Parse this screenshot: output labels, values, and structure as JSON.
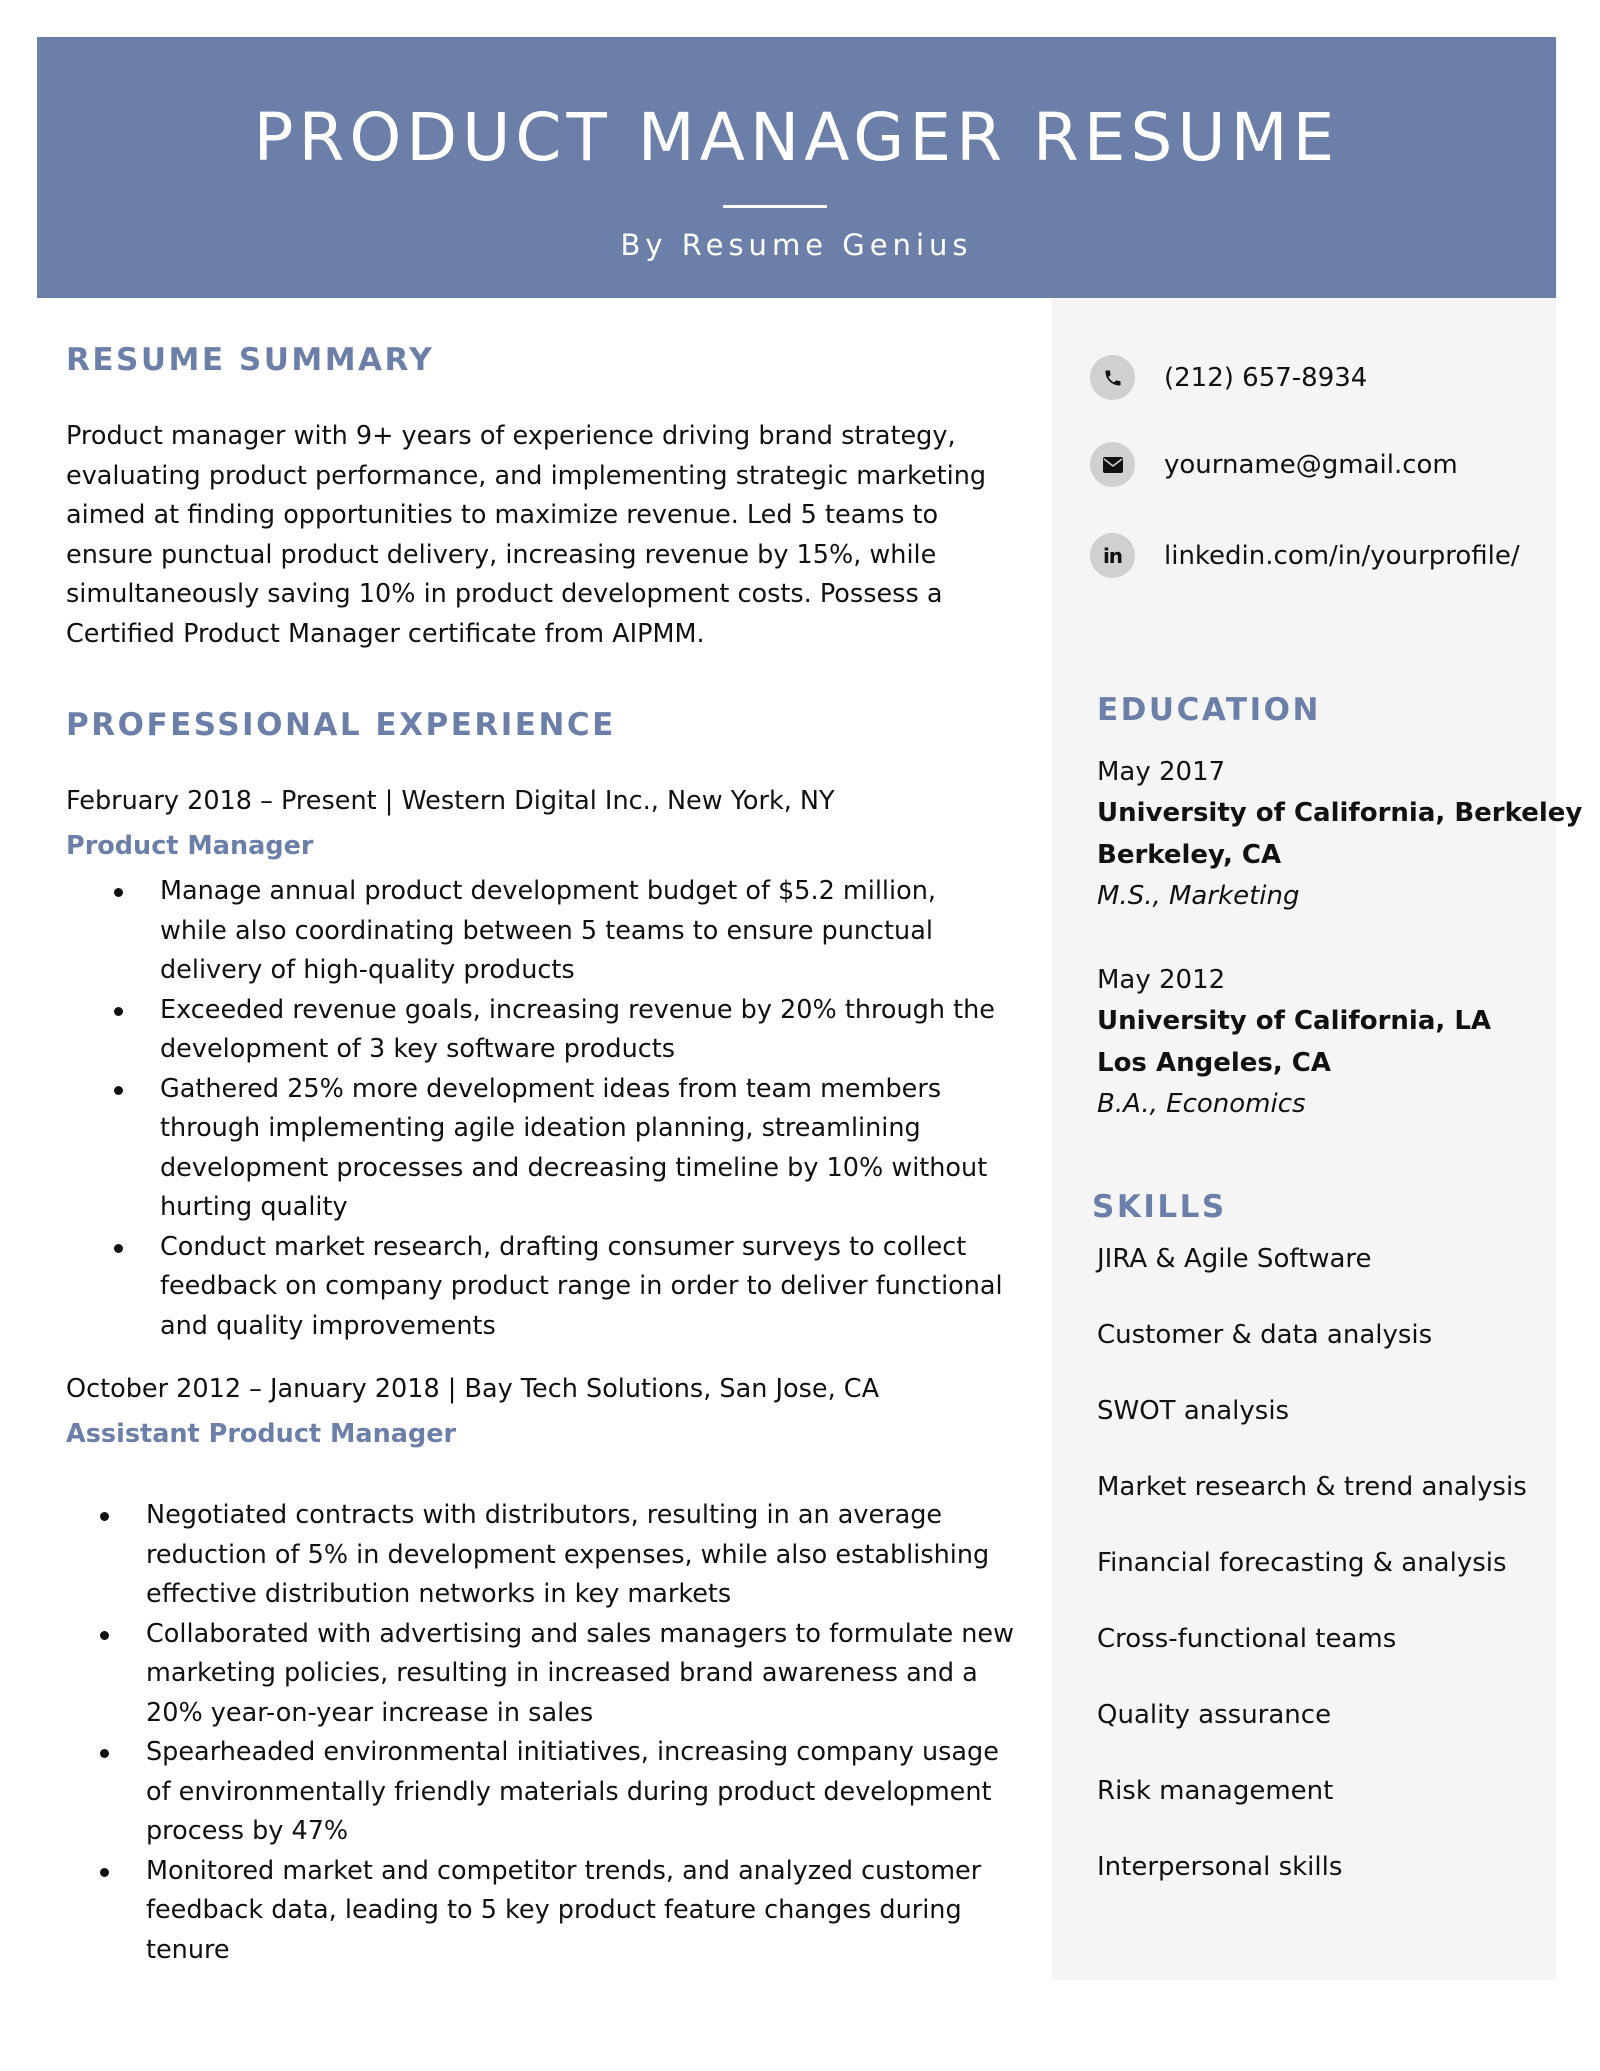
{
  "header": {
    "title": "PRODUCT MANAGER RESUME",
    "byline": "By Resume Genius"
  },
  "colors": {
    "accent": "#6C7FA8",
    "sidebar_bg": "#F5F5F5",
    "icon_circle": "#D0D0D0",
    "text": "#111111"
  },
  "summary": {
    "heading": "RESUME SUMMARY",
    "lines": [
      "Product manager with 9+ years of experience driving brand strategy,",
      "evaluating product performance, and implementing strategic marketing",
      "aimed at finding opportunities to maximize revenue. Led 5 teams to",
      "ensure punctual product delivery, increasing revenue by 15%, while",
      "simultaneously saving 10% in product development costs. Possess a",
      "Certified Product Manager certificate from AIPMM."
    ]
  },
  "experience": {
    "heading": "PROFESSIONAL EXPERIENCE",
    "jobs": [
      {
        "meta": "February 2018 – Present | Western Digital Inc., New York, NY",
        "title": "Product Manager",
        "bullets": [
          [
            "Manage annual product development budget of $5.2 million,",
            "while also coordinating between 5 teams to ensure punctual",
            "delivery of high-quality products"
          ],
          [
            "Exceeded revenue goals, increasing revenue by 20% through the",
            "development of 3 key software products"
          ],
          [
            "Gathered 25% more development ideas from team members",
            "through implementing agile ideation planning, streamlining",
            "development processes and decreasing timeline by 10% without",
            "hurting quality"
          ],
          [
            "Conduct market research, drafting consumer surveys to collect",
            "feedback on company product range in order to deliver functional",
            "and quality improvements"
          ]
        ]
      },
      {
        "meta": "October 2012 – January 2018 | Bay Tech Solutions, San Jose, CA",
        "title": "Assistant Product Manager",
        "bullets": [
          [
            "Negotiated contracts with distributors, resulting in an average",
            "reduction of 5% in development expenses, while also establishing",
            "effective distribution networks in key markets"
          ],
          [
            "Collaborated with advertising and sales managers to formulate new",
            "marketing policies, resulting in increased brand awareness and a",
            "20% year-on-year increase in sales"
          ],
          [
            "Spearheaded environmental initiatives, increasing company usage",
            "of environmentally friendly materials during product development",
            "process by 47%"
          ],
          [
            "Monitored market and competitor trends, and analyzed customer",
            "feedback data, leading to 5 key product feature changes during",
            "tenure"
          ]
        ]
      }
    ]
  },
  "contact": {
    "phone": {
      "icon": "phone-icon",
      "text": "(212) 657-8934"
    },
    "email": {
      "icon": "mail-icon",
      "text": "yourname@gmail.com"
    },
    "linkedin": {
      "icon": "linkedin-icon",
      "icon_text": "in",
      "text": "linkedin.com/in/yourprofile/"
    }
  },
  "education": {
    "heading": "EDUCATION",
    "entries": [
      {
        "date": "May 2017",
        "school": "University of California, Berkeley",
        "location": "Berkeley, CA",
        "degree": "M.S., Marketing"
      },
      {
        "date": "May 2012",
        "school": "University of California, LA",
        "location": "Los Angeles, CA",
        "degree": "B.A., Economics"
      }
    ]
  },
  "skills": {
    "heading": "SKILLS",
    "items": [
      "JIRA & Agile Software",
      "Customer & data analysis",
      "SWOT analysis",
      "Market research & trend analysis",
      "Financial forecasting & analysis",
      "Cross-functional teams",
      "Quality assurance",
      "Risk management",
      "Interpersonal skills"
    ]
  }
}
